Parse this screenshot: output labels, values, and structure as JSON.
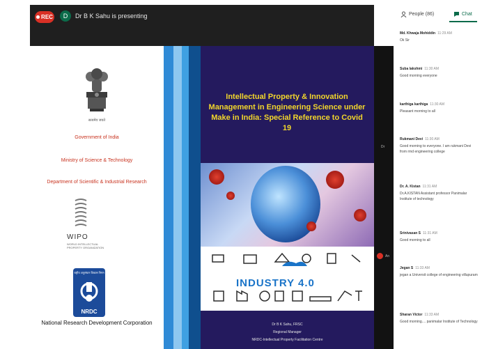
{
  "header": {
    "rec_label": "REC",
    "presenter_initial": "D",
    "presenting_text": "Dr B K Sahu is presenting"
  },
  "tabs": {
    "people_label": "People (86)",
    "chat_label": "Chat"
  },
  "chat": [
    {
      "name": "Md. Khwaja Mohiddin",
      "time": "11:29 AM",
      "text": "Ok Sir"
    },
    {
      "name": "Suba lakshmi",
      "time": "11:30 AM",
      "text": "Good morning everyone"
    },
    {
      "name": "karthiga karthiga",
      "time": "11:30 AM",
      "text": "Pleasant morning to all"
    },
    {
      "name": "Rukmani Devi",
      "time": "11:30 AM",
      "text": "Good morning to everyone. I am rukmani Devi from rmd engineering college"
    },
    {
      "name": "Dr. A. Kistan",
      "time": "11:31 AM",
      "text": "Dr.A.KISTAN Assistant professor Panimalar Institute of technology"
    },
    {
      "name": "Srinivasan S",
      "time": "11:31 AM",
      "text": "Good morning to all"
    },
    {
      "name": "Jegan S",
      "time": "11:33 AM",
      "text": "jegan a Universit college of engineering villupuram"
    },
    {
      "name": "Sharan Victor",
      "time": "11:33 AM",
      "text": "Good morning.... panimalar Institute of Technology"
    }
  ],
  "slide": {
    "emblem_caption": "सत्यमेव जयते",
    "gov_india": "Government of India",
    "ministry": "Ministry of Science & Technology",
    "department": "Department of Scientific & Industrial Research",
    "wipo": "WIPO",
    "wipo_sub": "WORLD INTELLECTUAL PROPERTY ORGANIZATION",
    "nrdc_top": "राष्ट्रीय अनुसंधान विकास निगम",
    "nrdc": "NRDC",
    "nrdc_full": "National Research Development Corporation",
    "title": "Intellectual Property & Innovation Management in Engineering Science under Make in India: Special Reference to Covid 19",
    "industry_label": "INDUSTRY 4.0",
    "credit_name": "Dr B K Sahu, FRSC",
    "credit_role": "Regional Manager",
    "credit_org": "NRDC-Intellectual Property Facilitation Centre"
  },
  "side_tags": {
    "top": "Dr",
    "bottom": "An"
  }
}
